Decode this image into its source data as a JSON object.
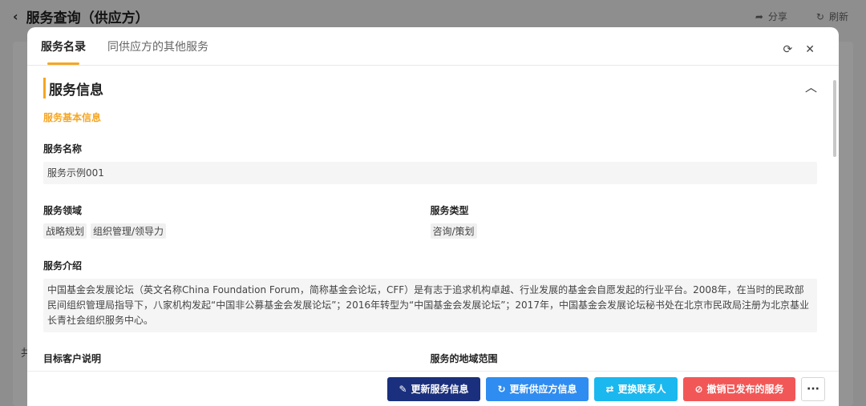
{
  "background": {
    "back_icon": "‹",
    "title": "服务查询（供应方）",
    "share_label": "分享",
    "refresh_label": "刷新",
    "side_text": "共"
  },
  "modal": {
    "tabs": [
      {
        "label": "服务名录",
        "active": true
      },
      {
        "label": "同供应方的其他服务",
        "active": false
      }
    ],
    "section_title": "服务信息",
    "sub_title": "服务基本信息",
    "service_name": {
      "label": "服务名称",
      "value": "服务示例001"
    },
    "service_domain": {
      "label": "服务领域",
      "tags": [
        "战略规划",
        "组织管理/领导力"
      ]
    },
    "service_type": {
      "label": "服务类型",
      "tags": [
        "咨询/策划"
      ]
    },
    "service_intro": {
      "label": "服务介绍",
      "value": "中国基金会发展论坛（英文名称China Foundation Forum，简称基金会论坛，CFF）是有志于追求机构卓越、行业发展的基金会自愿发起的行业平台。2008年，在当时的民政部民间组织管理局指导下，八家机构发起“中国非公募基金会发展论坛”；2016年转型为“中国基金会发展论坛”；2017年，中国基金会发展论坛秘书处在北京市民政局注册为北京基业长青社会组织服务中心。"
    },
    "target_customer": {
      "label": "目标客户说明"
    },
    "service_region": {
      "label": "服务的地域范围"
    }
  },
  "footer": {
    "update_service": "更新服务信息",
    "update_supplier": "更新供应方信息",
    "change_contact": "更换联系人",
    "revoke_service": "撤销已发布的服务",
    "more": "···"
  },
  "colors": {
    "accent": "#f5a623",
    "navy": "#1a2f7d",
    "blue": "#2f8cf0",
    "cyan": "#1ab8ef",
    "red": "#f25757"
  }
}
